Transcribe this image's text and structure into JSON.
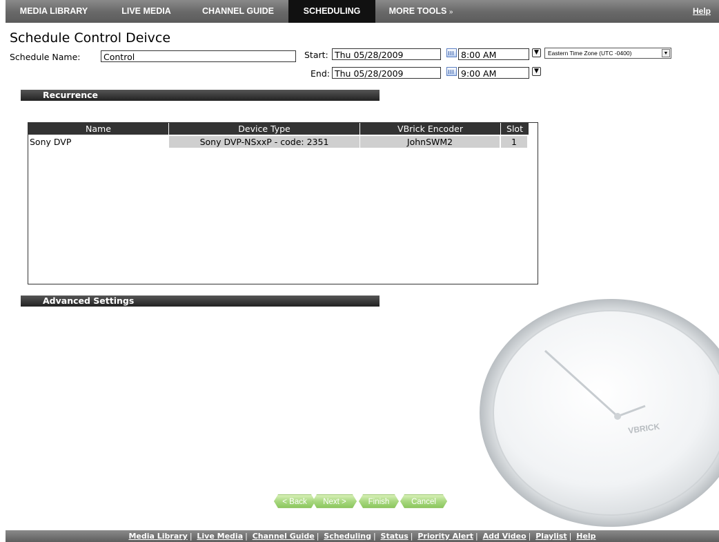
{
  "nav": {
    "items": [
      {
        "label": "MEDIA LIBRARY"
      },
      {
        "label": "LIVE MEDIA"
      },
      {
        "label": "CHANNEL GUIDE"
      },
      {
        "label": "SCHEDULING"
      },
      {
        "label": "MORE TOOLS"
      }
    ],
    "more_tools_arrow": "»",
    "help": "Help",
    "active": "SCHEDULING"
  },
  "page_title": "Schedule Control Deivce",
  "form": {
    "name_label": "Schedule Name:",
    "name_value": "Control",
    "start_label": "Start:",
    "start_date": "Thu 05/28/2009",
    "start_time": "8:00 AM",
    "end_label": "End:",
    "end_date": "Thu 05/28/2009",
    "end_time": "9:00 AM",
    "timezone": "Eastern Time Zone (UTC -0400)"
  },
  "sections": {
    "recurrence": "Recurrence",
    "advanced": "Advanced Settings"
  },
  "device_table": {
    "headers": [
      "Name",
      "Device Type",
      "VBrick Encoder",
      "Slot"
    ],
    "rows": [
      {
        "name": "Sony DVP",
        "device_type": "Sony DVP-NSxxP - code: 2351",
        "encoder": "JohnSWM2",
        "slot": "1"
      }
    ]
  },
  "wizard": {
    "back": "< Back",
    "next": "Next >",
    "finish": "Finish",
    "cancel": "Cancel"
  },
  "clock_brand": "VBRICK",
  "footer_links": [
    "Media Library",
    "Live Media",
    "Channel Guide",
    "Scheduling",
    "Status",
    "Priority Alert",
    "Add Video",
    "Playlist",
    "Help"
  ],
  "colors": {
    "nav_active": "#111111",
    "section_bar": "#333333",
    "wizard_button": "#a9d880"
  }
}
